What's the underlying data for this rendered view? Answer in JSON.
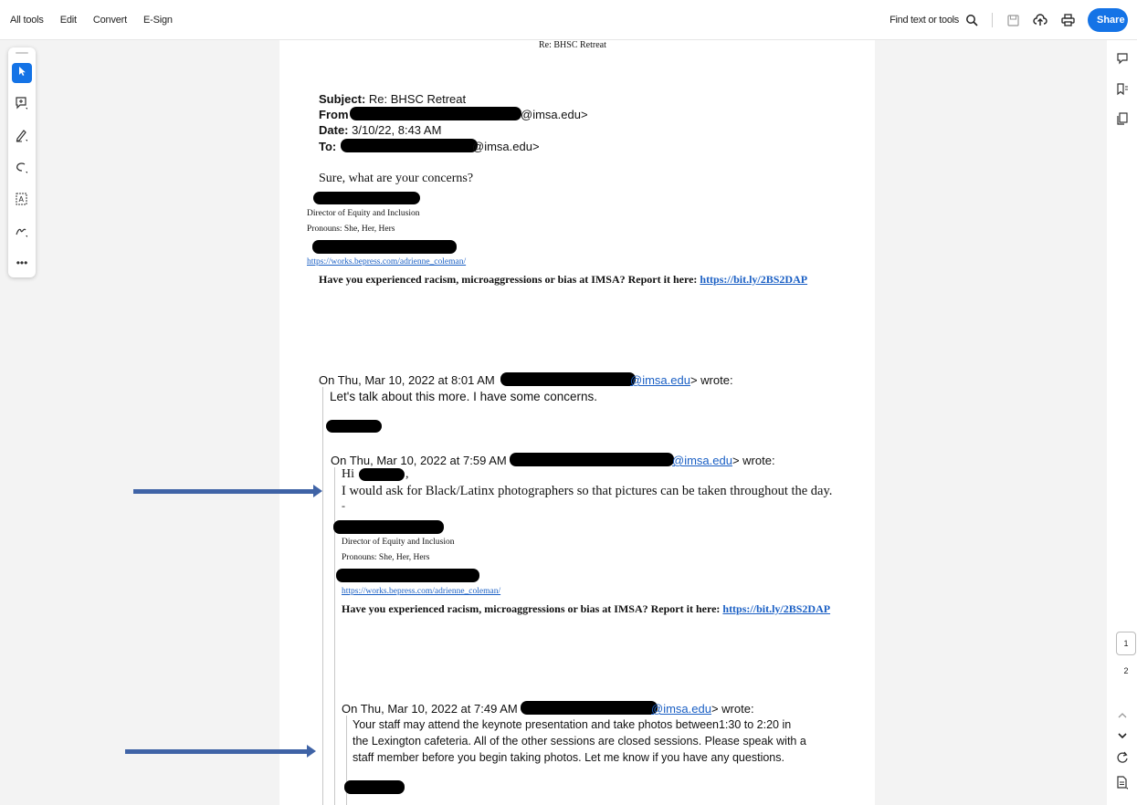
{
  "menu": {
    "all_tools": "All tools",
    "edit": "Edit",
    "convert": "Convert",
    "esign": "E-Sign"
  },
  "toolbar": {
    "find_label": "Find text or tools",
    "share_label": "Share"
  },
  "document": {
    "running_title": "Re: BHSC Retreat",
    "subject_label": "Subject:",
    "subject_value": "Re: BHSC Retreat",
    "from_label": "From",
    "from_domain": "@imsa.edu>",
    "date_label": "Date:",
    "date_value": "3/10/22, 8:43 AM",
    "to_label": "To:",
    "to_domain": "@imsa.edu>",
    "reply_text": "Sure, what are your concerns?",
    "sig_title": "Director of Equity and Inclusion",
    "sig_pronouns": "Pronouns: She, Her, Hers",
    "sig_link": "https://works.bepress.com/adrienne_coleman/",
    "report_text": "Have you experienced racism, microaggressions or bias at IMSA? Report it here:",
    "report_link": "https://bit.ly/2BS2DAP",
    "q1_header_prefix": "On Thu, Mar 10, 2022 at 8:01 AM",
    "q1_domain": "@imsa.edu",
    "q1_wrote": "> wrote:",
    "q1_text": "Let's talk about this more. I have some concerns.",
    "q2_header_prefix": "On Thu, Mar 10, 2022 at 7:59 AM",
    "q2_domain": "@imsa.edu",
    "q2_wrote": "> wrote:",
    "q2_greeting": "Hi",
    "q2_greeting_end": ",",
    "q2_text": "I would ask for Black/Latinx photographers so that pictures can be taken throughout the day.",
    "q2_dash": "-",
    "q3_header_prefix": "On Thu, Mar 10, 2022 at 7:49 AM",
    "q3_domain": "@imsa.edu",
    "q3_wrote": "> wrote:",
    "q3_lines": [
      "Your staff may attend the keynote presentation and take photos between1:30 to 2:20 in",
      "the Lexington cafeteria. All of the other sessions are closed sessions. Please speak with a",
      "staff member before you begin taking photos. Let me know if you have any questions."
    ]
  },
  "pagination": {
    "current": "1",
    "next": "2"
  },
  "colors": {
    "accent": "#1473e6",
    "arrow": "#3f63a6",
    "link": "#1a5fc4"
  }
}
